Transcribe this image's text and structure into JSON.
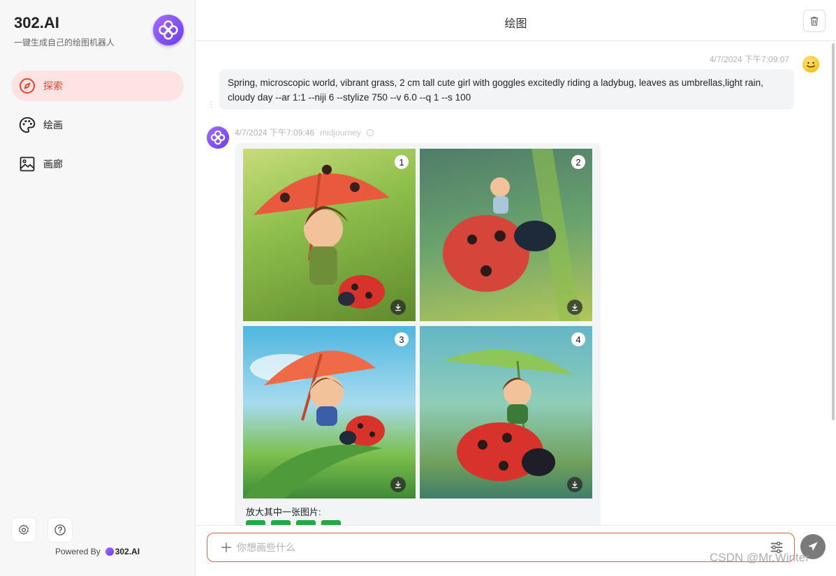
{
  "sidebar": {
    "brand_title": "302.AI",
    "brand_subtitle": "一键生成自己的绘图机器人",
    "items": [
      {
        "label": "探索",
        "icon": "compass-icon",
        "active": true
      },
      {
        "label": "绘画",
        "icon": "palette-icon",
        "active": false
      },
      {
        "label": "画廊",
        "icon": "image-icon",
        "active": false
      }
    ],
    "powered_by": "Powered By",
    "powered_brand": "302.AI"
  },
  "header": {
    "title": "绘图"
  },
  "chat": {
    "user_message": {
      "timestamp": "4/7/2024 下午7:09:07",
      "text": "Spring, microscopic world, vibrant grass, 2 cm tall cute girl with goggles excitedly riding a ladybug, leaves as umbrellas,light rain, cloudy day --ar 1:1 --niji 6 --stylize 750 --v 6.0  --q 1  --s 100"
    },
    "bot_message": {
      "timestamp": "4/7/2024 下午7:09:46",
      "model": "midjourney",
      "images": [
        {
          "number": "1"
        },
        {
          "number": "2"
        },
        {
          "number": "3"
        },
        {
          "number": "4"
        }
      ],
      "enlarge_label": "放大其中一张图片:"
    }
  },
  "input": {
    "placeholder": "你想画些什么"
  },
  "watermark": "CSDN @Mr.Winter",
  "colors": {
    "accent": "#e2432f",
    "active_bg": "#fde4e3",
    "brand_purple": "#7b4cf0",
    "upscale_green": "#28a745"
  }
}
